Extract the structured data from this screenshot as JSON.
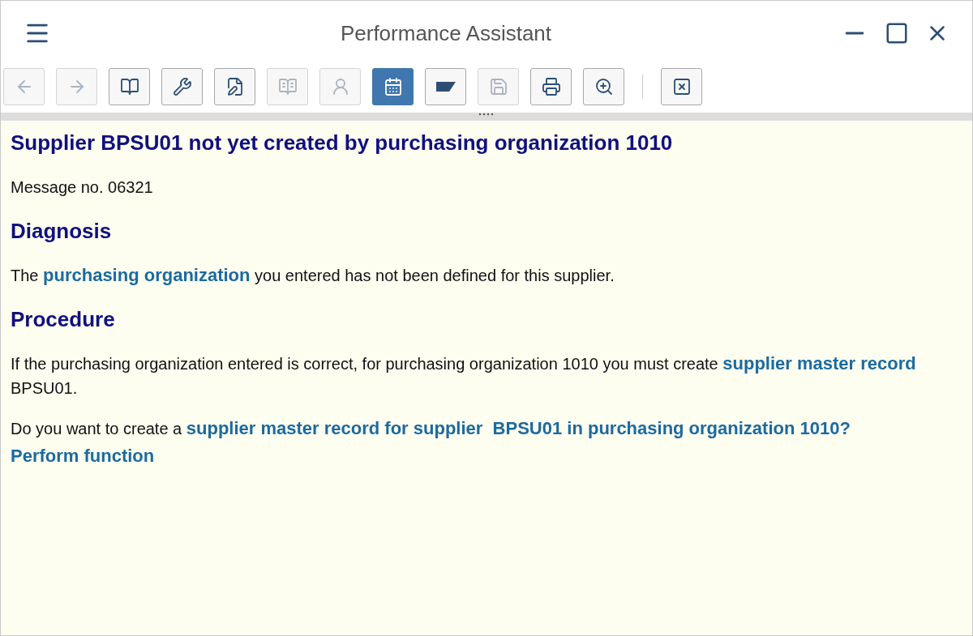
{
  "window": {
    "title": "Performance Assistant"
  },
  "toolbar": {
    "buttons": [
      {
        "kind": "back",
        "disabled": true,
        "selected": false
      },
      {
        "kind": "forward",
        "disabled": true,
        "selected": false
      },
      {
        "kind": "help",
        "disabled": false,
        "selected": false
      },
      {
        "kind": "technical",
        "disabled": false,
        "selected": false
      },
      {
        "kind": "edit",
        "disabled": false,
        "selected": false
      },
      {
        "kind": "book",
        "disabled": true,
        "selected": false
      },
      {
        "kind": "user-key",
        "disabled": true,
        "selected": false
      },
      {
        "kind": "calendar",
        "disabled": false,
        "selected": true
      },
      {
        "kind": "flag",
        "disabled": false,
        "selected": false
      },
      {
        "kind": "export",
        "disabled": true,
        "selected": false
      },
      {
        "kind": "print",
        "disabled": false,
        "selected": false
      },
      {
        "kind": "zoom",
        "disabled": false,
        "selected": false
      }
    ],
    "end_buttons": [
      {
        "kind": "close",
        "disabled": false,
        "selected": false
      }
    ]
  },
  "content": [
    {
      "kind": "title",
      "parts": [
        {
          "text": "Supplier BPSU01 not yet created by purchasing organization 1010",
          "kind": "text"
        }
      ]
    },
    {
      "kind": "text",
      "parts": [
        {
          "text": "Message no. 06321",
          "kind": "text"
        }
      ]
    },
    {
      "kind": "heading",
      "parts": [
        {
          "text": "Diagnosis",
          "kind": "text"
        }
      ]
    },
    {
      "kind": "text",
      "parts": [
        {
          "text": "The ",
          "kind": "text"
        },
        {
          "text": "purchasing organization",
          "kind": "link"
        },
        {
          "text": " you entered has not been defined for this supplier.",
          "kind": "text"
        }
      ]
    },
    {
      "kind": "heading",
      "parts": [
        {
          "text": "Procedure",
          "kind": "text"
        }
      ]
    },
    {
      "kind": "text",
      "parts": [
        {
          "text": "If the purchasing organization entered is correct, for purchasing organization 1010 you must create ",
          "kind": "text"
        },
        {
          "text": "supplier master record",
          "kind": "link"
        },
        {
          "text": " BPSU01.",
          "kind": "text"
        }
      ]
    },
    {
      "kind": "text",
      "parts": [
        {
          "text": "Do you want to create a ",
          "kind": "text"
        },
        {
          "text": "supplier master record for supplier  BPSU01 in purchasing organization 1010?",
          "kind": "link"
        }
      ]
    },
    {
      "kind": "action",
      "parts": [
        {
          "text": "Perform function",
          "kind": "link"
        }
      ]
    }
  ]
}
